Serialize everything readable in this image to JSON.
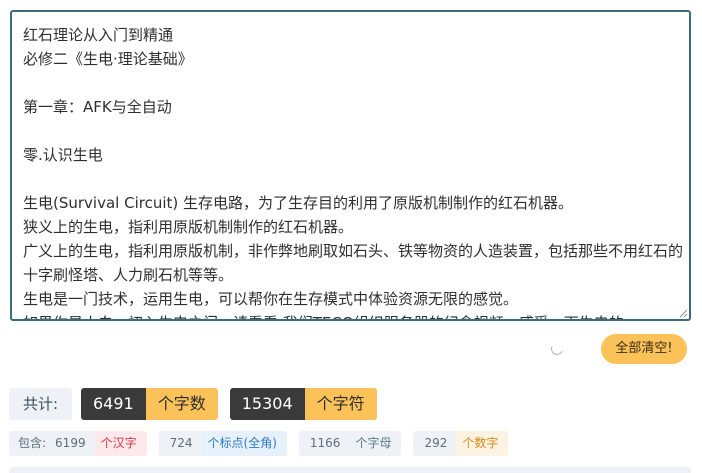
{
  "editor": {
    "text": "红石理论从入门到精通\n必修二《生电·理论基础》\n\n第一章：AFK与全自动\n\n零.认识生电\n\n生电(Survival Circuit) 生存电路，为了生存目的利用了原版机制制作的红石机器。\n狭义上的生电，指利用原版机制制作的红石机器。\n广义上的生电，指利用原版机制，非作弊地刷取如石头、铁等物资的人造装置，包括那些不用红石的十字刷怪塔、人力刷石机等等。\n生电是一门技术，运用生电，可以帮你在生存模式中体验资源无限的感觉。\n如果你是小白，初入生电之门，请看看 我们TECO组织服务器的纪念视频，感受一下生电的"
  },
  "clear_button": "全部清空!",
  "totals": {
    "label": "共计:",
    "chars_value": "6491",
    "chars_unit": "个字数",
    "symbols_value": "15304",
    "symbols_unit": "个字符"
  },
  "details": {
    "label": "包含:",
    "hanzi_value": "6199",
    "hanzi_unit": "个汉字",
    "punct_value": "724",
    "punct_unit": "个标点(全角)",
    "letters_value": "1166",
    "letters_unit": "个字母",
    "digits_value": "292",
    "digits_unit": "个数字"
  },
  "colors": {
    "accent_yellow": "#fbc25a",
    "dark": "#3a3a3a",
    "editor_border": "#3e6b7c"
  }
}
